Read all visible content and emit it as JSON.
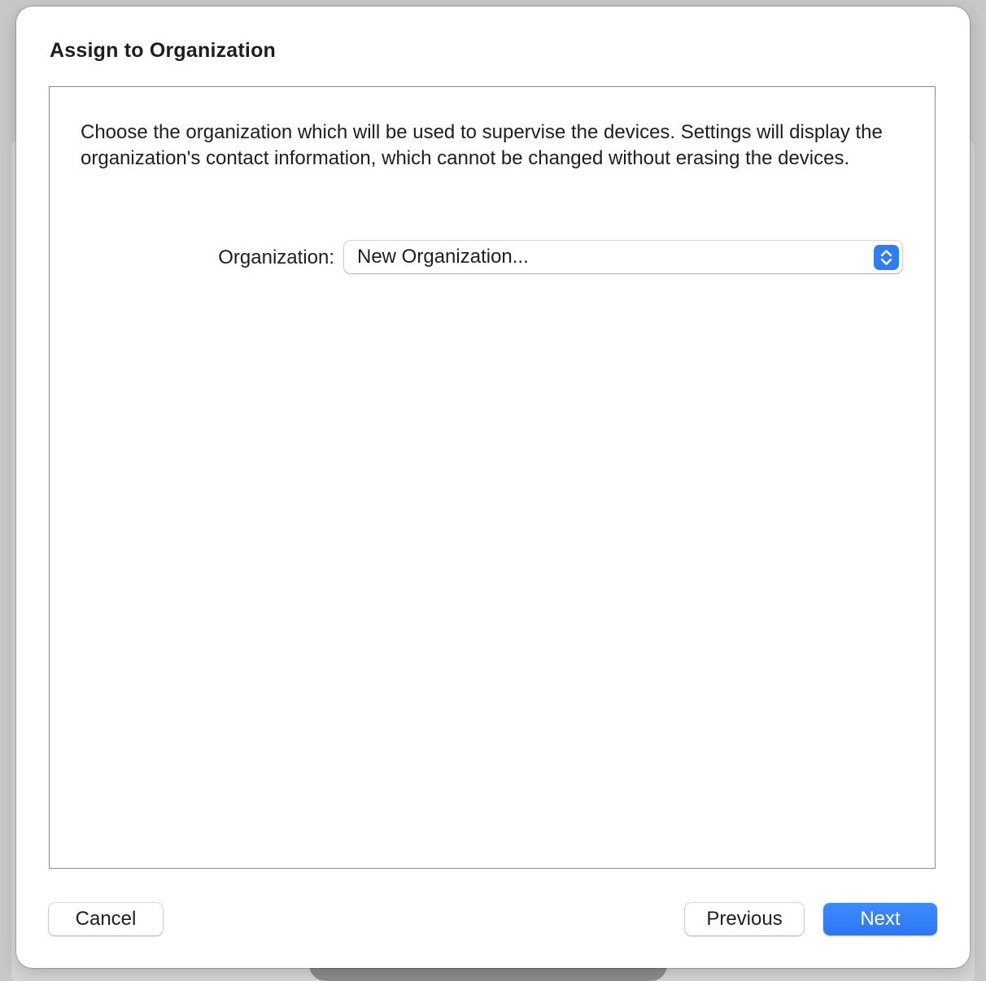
{
  "dialog": {
    "title": "Assign to Organization",
    "description": "Choose the organization which will be used to supervise the devices. Settings will display the organization's contact information, which cannot be changed without erasing the devices.",
    "organization_label": "Organization:",
    "organization_value": "New Organization..."
  },
  "buttons": {
    "cancel": "Cancel",
    "previous": "Previous",
    "next": "Next"
  },
  "colors": {
    "accent": "#2f7df6",
    "sheet_background": "#ffffff",
    "text": "#1e1e1e"
  },
  "icons": {
    "popup_arrows": "chevron-up-down-icon"
  }
}
